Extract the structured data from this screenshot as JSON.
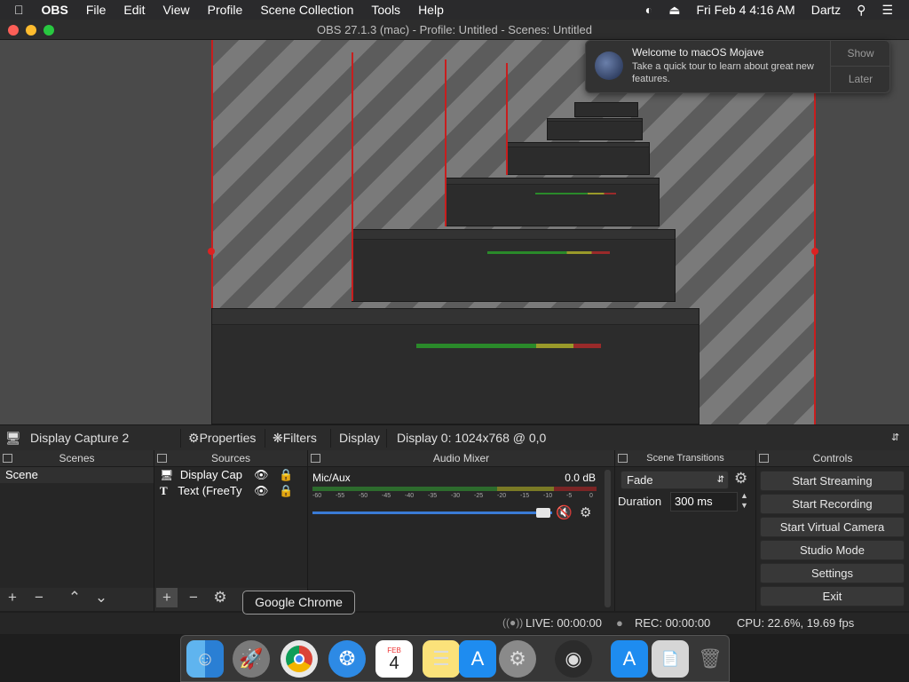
{
  "menubar": {
    "app": "OBS",
    "items": [
      "File",
      "Edit",
      "View",
      "Profile",
      "Scene Collection",
      "Tools",
      "Help"
    ],
    "datetime": "Fri Feb 4  4:16 AM",
    "user": "Dartz"
  },
  "window": {
    "title": "OBS 27.1.3 (mac) - Profile: Untitled - Scenes: Untitled"
  },
  "notification": {
    "title": "Welcome to macOS Mojave",
    "body": "Take a quick tour to learn about great new features.",
    "show_label": "Show",
    "later_label": "Later"
  },
  "source_toolbar": {
    "source_name": "Display Capture 2",
    "properties_label": "Properties",
    "filters_label": "Filters",
    "display_label": "Display",
    "display_value": "Display 0: 1024x768 @ 0,0"
  },
  "scenes": {
    "header": "Scenes",
    "items": [
      "Scene"
    ]
  },
  "sources": {
    "header": "Sources",
    "items": [
      {
        "name": "Display Cap",
        "icon": "monitor-icon"
      },
      {
        "name": "Text (FreeTy",
        "icon": "text-icon"
      }
    ]
  },
  "audio_mixer": {
    "header": "Audio Mixer",
    "channel": "Mic/Aux",
    "level": "0.0 dB",
    "scale": [
      "-60",
      "-55",
      "-50",
      "-45",
      "-40",
      "-35",
      "-30",
      "-25",
      "-20",
      "-15",
      "-10",
      "-5",
      "0"
    ]
  },
  "transitions": {
    "header": "Scene Transitions",
    "selected": "Fade",
    "duration_label": "Duration",
    "duration_value": "300 ms"
  },
  "controls": {
    "header": "Controls",
    "buttons": [
      "Start Streaming",
      "Start Recording",
      "Start Virtual Camera",
      "Studio Mode",
      "Settings",
      "Exit"
    ]
  },
  "status": {
    "live": "LIVE: 00:00:00",
    "rec": "REC: 00:00:00",
    "cpu": "CPU: 22.6%, 19.69 fps"
  },
  "tooltip": "Google Chrome",
  "dock": {
    "calendar_month": "FEB",
    "calendar_day": "4"
  },
  "colors": {
    "accent_red": "#c81e1e",
    "meter_green": "#2a8a2a",
    "slider_blue": "#3a7bd5"
  }
}
